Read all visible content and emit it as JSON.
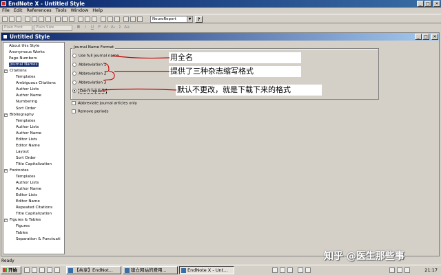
{
  "app": {
    "title": "EndNote X - Untitled Style",
    "window_buttons": [
      "_",
      "□",
      "✕"
    ]
  },
  "menu": [
    "File",
    "Edit",
    "References",
    "Tools",
    "Window",
    "Help"
  ],
  "toolbar": {
    "output_style": "NeuroReport",
    "help_label": "?"
  },
  "format_toolbar": {
    "font": "Plain Font",
    "size": "Plain Size",
    "bold": "B",
    "italic": "I",
    "underline": "U",
    "plain": "P",
    "superscript": "A¹",
    "subscript": "A₁",
    "symbol": "Σ",
    "case": "Aa"
  },
  "style_window": {
    "title": "Untitled Style",
    "buttons": [
      "_",
      "□",
      "✕"
    ]
  },
  "tree": [
    {
      "label": "About this Style",
      "level": 1
    },
    {
      "label": "Anonymous Works",
      "level": 1
    },
    {
      "label": "Page Numbers",
      "level": 1
    },
    {
      "label": "Journal Names",
      "level": 1,
      "selected": true
    },
    {
      "label": "Citations",
      "level": 0,
      "expander": "−"
    },
    {
      "label": "Templates",
      "level": 2
    },
    {
      "label": "Ambiguous Citations",
      "level": 2
    },
    {
      "label": "Author Lists",
      "level": 2
    },
    {
      "label": "Author Name",
      "level": 2
    },
    {
      "label": "Numbering",
      "level": 2
    },
    {
      "label": "Sort Order",
      "level": 2
    },
    {
      "label": "Bibliography",
      "level": 0,
      "expander": "−"
    },
    {
      "label": "Templates",
      "level": 2
    },
    {
      "label": "Author Lists",
      "level": 2
    },
    {
      "label": "Author Name",
      "level": 2
    },
    {
      "label": "Editor Lists",
      "level": 2
    },
    {
      "label": "Editor Name",
      "level": 2
    },
    {
      "label": "Layout",
      "level": 2
    },
    {
      "label": "Sort Order",
      "level": 2
    },
    {
      "label": "Title Capitalization",
      "level": 2
    },
    {
      "label": "Footnotes",
      "level": 0,
      "expander": "−"
    },
    {
      "label": "Templates",
      "level": 2
    },
    {
      "label": "Author Lists",
      "level": 2
    },
    {
      "label": "Author Name",
      "level": 2
    },
    {
      "label": "Editor Lists",
      "level": 2
    },
    {
      "label": "Editor Name",
      "level": 2
    },
    {
      "label": "Repeated Citations",
      "level": 2
    },
    {
      "label": "Title Capitalization",
      "level": 2
    },
    {
      "label": "Figures & Tables",
      "level": 0,
      "expander": "−"
    },
    {
      "label": "Figures",
      "level": 2
    },
    {
      "label": "Tables",
      "level": 2
    },
    {
      "label": "Separation & Punctuati",
      "level": 2
    }
  ],
  "journal_names": {
    "group_label": "Journal Name Format",
    "options": [
      {
        "label": "Use full journal name",
        "checked": false
      },
      {
        "label": "Abbreviation 1",
        "checked": false
      },
      {
        "label": "Abbreviation 2",
        "checked": false
      },
      {
        "label": "Abbreviation 3",
        "checked": false
      },
      {
        "label": "Don't replace",
        "checked": true
      }
    ],
    "checkboxes": [
      {
        "label": "Abbreviate journal articles only",
        "checked": false
      },
      {
        "label": "Remove periods",
        "checked": false
      }
    ]
  },
  "annotations": {
    "full_name": "用全名",
    "three_abbrev": "提供了三种杂志缩写格式",
    "default_note": "默认不更改，就是下载下来的格式",
    "color": "#c00000"
  },
  "status": {
    "text": "Ready"
  },
  "watermark": "知乎 @医生那些事",
  "taskbar": {
    "start": "开始",
    "tasks": [
      {
        "label": "【共享】EndNot...",
        "active": false
      },
      {
        "label": "建立网站的费用...",
        "active": false
      },
      {
        "label": "EndNote X - Unt...",
        "active": true
      }
    ],
    "clock": "21:17"
  }
}
